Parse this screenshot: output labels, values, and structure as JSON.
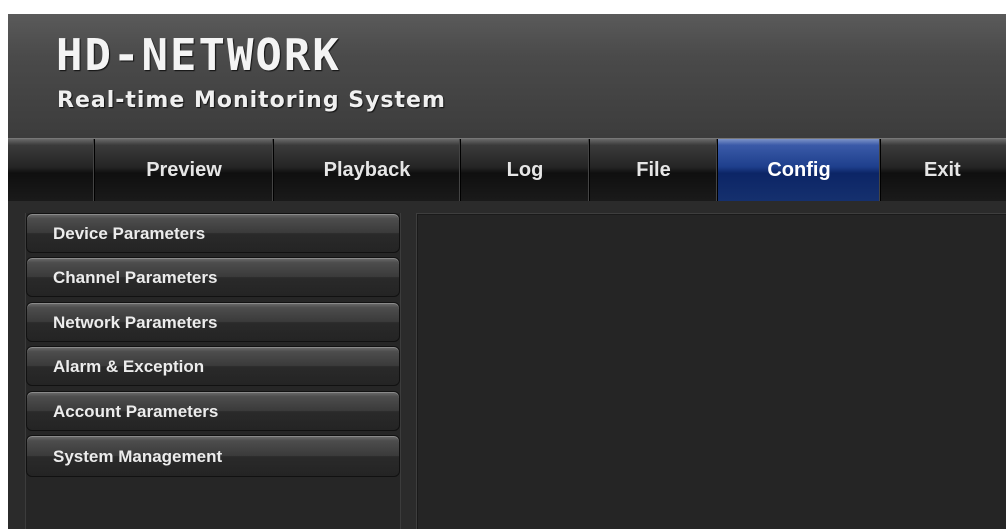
{
  "header": {
    "title": "HD-NETWORK",
    "subtitle": "Real-time Monitoring System"
  },
  "nav": {
    "items": [
      {
        "label": "Preview",
        "active": false
      },
      {
        "label": "Playback",
        "active": false
      },
      {
        "label": "Log",
        "active": false
      },
      {
        "label": "File",
        "active": false
      },
      {
        "label": "Config",
        "active": true
      },
      {
        "label": "Exit",
        "active": false
      }
    ]
  },
  "sidebar": {
    "items": [
      {
        "label": "Device Parameters"
      },
      {
        "label": "Channel Parameters"
      },
      {
        "label": "Network Parameters"
      },
      {
        "label": "Alarm & Exception"
      },
      {
        "label": "Account Parameters"
      },
      {
        "label": "System Management"
      }
    ]
  },
  "colors": {
    "active_tab": "#1e3f8c",
    "background": "#2a2a2a",
    "text": "#e6e6e6"
  }
}
